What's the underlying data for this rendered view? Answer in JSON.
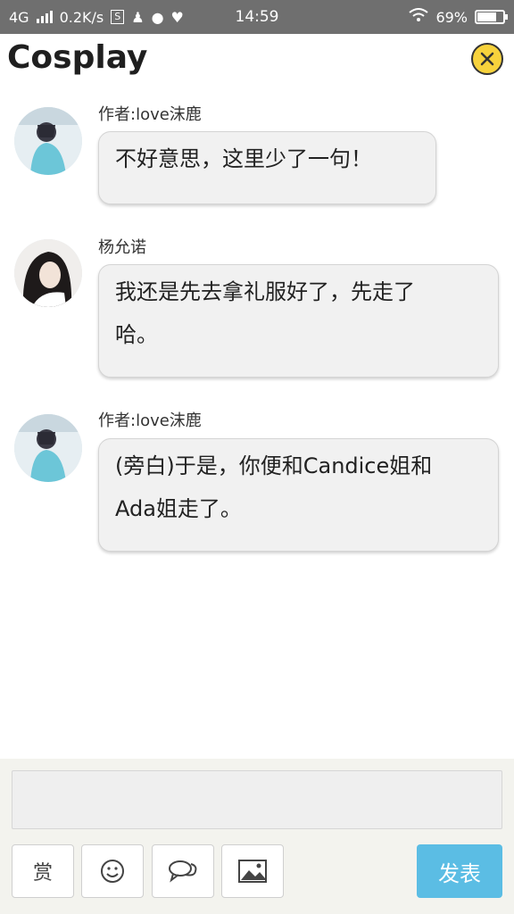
{
  "status_bar": {
    "network": "4G",
    "speed": "0.2K/s",
    "sim_box": "S",
    "time": "14:59",
    "battery_text": "69%",
    "battery_level": 0.69
  },
  "header": {
    "title": "Cosplay",
    "close_icon": "close-icon",
    "accent_color": "#f7d23c"
  },
  "messages": [
    {
      "sender": "作者:love沫鹿",
      "text_lines": [
        "不好意思，这里少了一句！"
      ]
    },
    {
      "sender": "杨允诺",
      "text_lines": [
        "我还是先去拿礼服好了，先走了",
        "哈。"
      ]
    },
    {
      "sender": "作者:love沫鹿",
      "text_lines": [
        "(旁白)于是，你便和Candice姐和",
        "Ada姐走了。"
      ]
    }
  ],
  "composer": {
    "input_value": "",
    "tip_label": "赏",
    "emoji_icon": "emoji-icon",
    "chat_icon": "chat-bubbles-icon",
    "image_icon": "image-icon",
    "send_label": "发表",
    "send_color": "#5bbde4"
  }
}
